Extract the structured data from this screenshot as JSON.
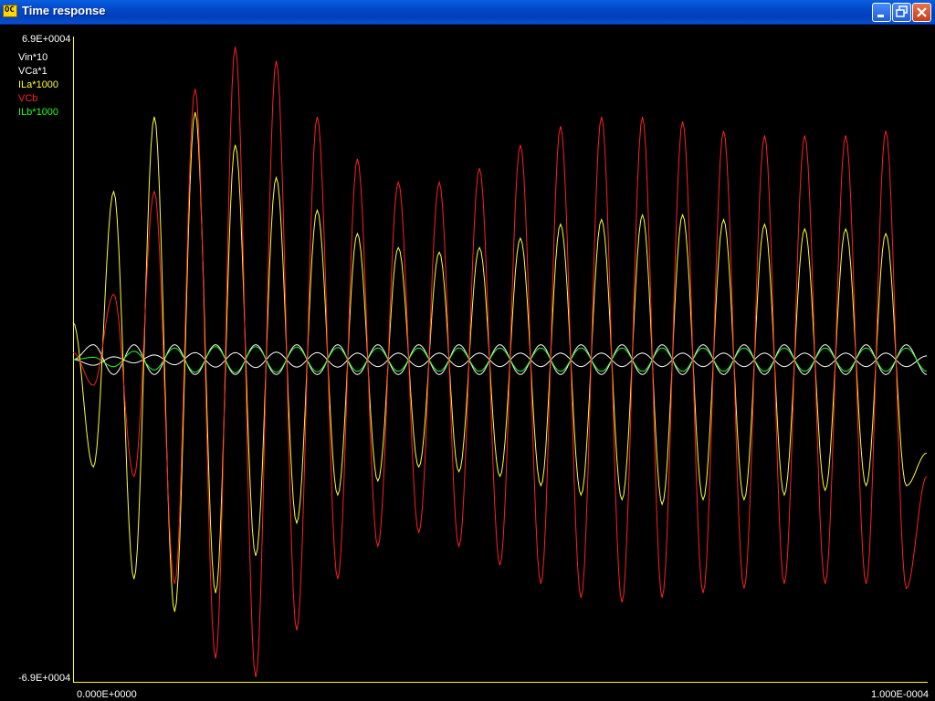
{
  "window": {
    "title": "Time response",
    "icon": "app-logo-icon"
  },
  "controls": {
    "minimize": "minimize-icon",
    "maximize": "restore-icon",
    "close": "close-icon"
  },
  "chart_data": {
    "type": "line",
    "ylim": [
      -69000,
      69000
    ],
    "xlim": [
      0,
      0.0001
    ],
    "ytick_labels": {
      "top": "6.9E+0004",
      "bottom": "-6.9E+0004"
    },
    "xtick_labels": {
      "left": "0.000E+0000",
      "right": "1.000E-0004"
    },
    "x": [
      0.0,
      2.38e-06,
      4.76e-06,
      7.14e-06,
      9.52e-06,
      1.19e-05,
      1.43e-05,
      1.67e-05,
      1.9e-05,
      2.14e-05,
      2.38e-05,
      2.62e-05,
      2.86e-05,
      3.1e-05,
      3.33e-05,
      3.57e-05,
      3.81e-05,
      4.05e-05,
      4.29e-05,
      4.52e-05,
      4.76e-05,
      5e-05,
      5.24e-05,
      5.48e-05,
      5.71e-05,
      5.95e-05,
      6.19e-05,
      6.43e-05,
      6.67e-05,
      6.9e-05,
      7.14e-05,
      7.38e-05,
      7.62e-05,
      7.86e-05,
      8.1e-05,
      8.33e-05,
      8.57e-05,
      8.81e-05,
      9.05e-05,
      9.29e-05,
      9.52e-05,
      9.76e-05,
      0.0001
    ],
    "series": [
      {
        "name": "Vin*10",
        "color": "#ffffff",
        "values": [
          0,
          3200,
          -3200,
          3200,
          -3200,
          3200,
          -3200,
          3200,
          -3200,
          3200,
          -3200,
          3200,
          -3200,
          3200,
          -3200,
          3200,
          -3200,
          3200,
          -3200,
          3200,
          -3200,
          3200,
          -3200,
          3200,
          -3200,
          3200,
          -3200,
          3200,
          -3200,
          3200,
          -3200,
          3200,
          -3200,
          3200,
          -3200,
          3200,
          -3200,
          3200,
          -3200,
          3200,
          -3200,
          3200,
          -3200
        ]
      },
      {
        "name": "VCa*1",
        "color": "#ffffff",
        "values": [
          0,
          -1200,
          600,
          -700,
          1000,
          -1100,
          1500,
          -1600,
          1500,
          -1700,
          1600,
          -1600,
          1500,
          -1600,
          1400,
          -1500,
          1400,
          -1500,
          1400,
          -1500,
          1400,
          -1500,
          1400,
          -1500,
          1400,
          -1500,
          1400,
          -1500,
          1400,
          -1500,
          1400,
          -1500,
          1400,
          -1500,
          1400,
          -1500,
          1400,
          -1500,
          1400,
          -1500,
          1400,
          -1500,
          800
        ]
      },
      {
        "name": "ILa*1000",
        "color": "#ffff30",
        "values": [
          8000,
          -23000,
          36000,
          -47000,
          52000,
          -54000,
          53000,
          -50000,
          46000,
          -42000,
          39000,
          -35000,
          32000,
          -29000,
          27000,
          -26000,
          24000,
          -23000,
          23000,
          -24000,
          24000,
          -25000,
          26000,
          -27000,
          29000,
          -29000,
          30000,
          -30000,
          31000,
          -31000,
          31000,
          -30000,
          30000,
          -30000,
          29000,
          -29000,
          28000,
          -28000,
          28000,
          -27000,
          27000,
          -27000,
          -20000
        ]
      },
      {
        "name": "VCb",
        "color": "#ff2020",
        "values": [
          1500,
          -5500,
          14000,
          -25000,
          36000,
          -48000,
          58000,
          -64000,
          67000,
          -68000,
          64000,
          -58000,
          52000,
          -47000,
          43000,
          -40000,
          38000,
          -37000,
          38000,
          -40000,
          41000,
          -44000,
          46000,
          -48000,
          50000,
          -51000,
          52000,
          -52000,
          52000,
          -51000,
          51000,
          -50000,
          49000,
          -49000,
          48000,
          -48000,
          48000,
          -48000,
          48000,
          -48000,
          49000,
          -49000,
          -25000
        ]
      },
      {
        "name": "ILb*1000",
        "color": "#20ff20",
        "values": [
          0,
          500,
          -1500,
          1800,
          -2200,
          2500,
          -2700,
          2800,
          -2800,
          2800,
          -2700,
          2700,
          -2600,
          2600,
          -2500,
          2500,
          -2500,
          2500,
          -2500,
          2500,
          -2500,
          2500,
          -2500,
          2500,
          -2500,
          2500,
          -2500,
          2500,
          -2500,
          2500,
          -2500,
          2500,
          -2500,
          2500,
          -2500,
          2500,
          -2500,
          2500,
          -2500,
          2500,
          -2500,
          2500,
          -2500
        ]
      }
    ]
  }
}
